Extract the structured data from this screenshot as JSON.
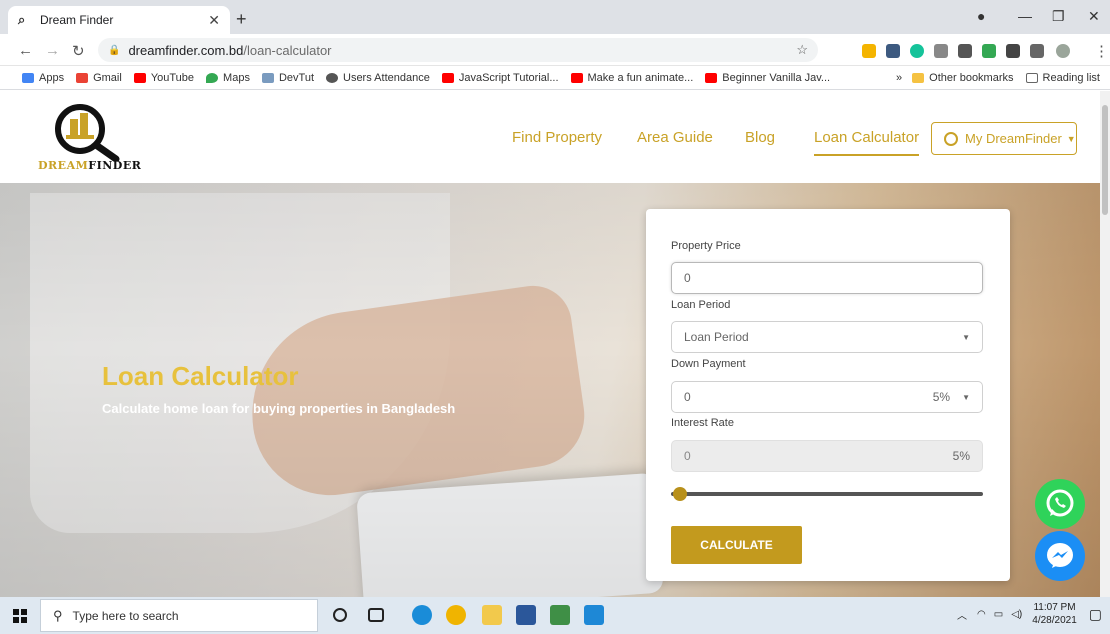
{
  "browser": {
    "tab_title": "Dream Finder",
    "url_host": "dreamfinder.com.bd",
    "url_path": "/loan-calculator"
  },
  "bookmarks": {
    "items": [
      "Apps",
      "Gmail",
      "YouTube",
      "Maps",
      "DevTut",
      "Users Attendance",
      "JavaScript Tutorial...",
      "Make a fun animate...",
      "Beginner Vanilla Jav..."
    ],
    "overflow": "»",
    "other": "Other bookmarks",
    "reading": "Reading list"
  },
  "site": {
    "logo_text": "DreamFinder",
    "nav": [
      "Find Property",
      "Area Guide",
      "Blog",
      "Loan Calculator"
    ],
    "account_button": "My DreamFinder"
  },
  "hero": {
    "title": "Loan Calculator",
    "subtitle": "Calculate home loan for buying properties in Bangladesh"
  },
  "form": {
    "property_price_label": "Property Price",
    "property_price_value": "0",
    "loan_period_label": "Loan Period",
    "loan_period_placeholder": "Loan Period",
    "down_payment_label": "Down Payment",
    "down_payment_value": "0",
    "down_payment_pct": "5%",
    "interest_rate_label": "Interest Rate",
    "interest_rate_value": "0",
    "interest_rate_pct": "5%",
    "slider_level": 0.03,
    "calculate_button": "CALCULATE"
  },
  "taskbar": {
    "search_placeholder": "Type here to search",
    "time": "11:07 PM",
    "date": "4/28/2021"
  },
  "colors": {
    "brand_gold": "#c9a227",
    "whatsapp": "#2fd35a",
    "messenger": "#1b8ef5"
  }
}
